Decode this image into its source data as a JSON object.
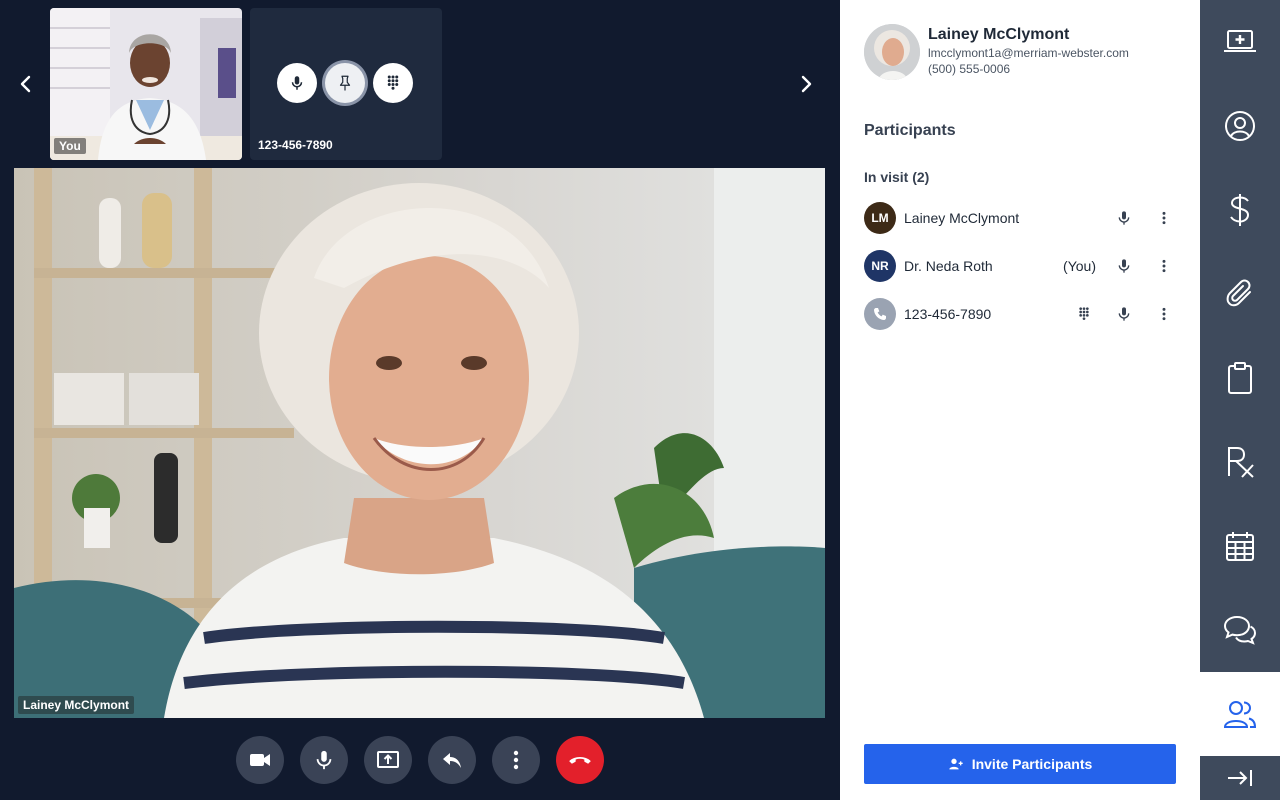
{
  "thumbnails": {
    "self_label": "You",
    "phone_label": "123-456-7890"
  },
  "main_video": {
    "speaker_label": "Lainey McClymont"
  },
  "patient": {
    "name": "Lainey McClymont",
    "email": "lmcclymont1a@merriam-webster.com",
    "phone": "(500) 555-0006"
  },
  "participants_panel": {
    "title": "Participants",
    "section_title": "In visit (2)",
    "items": [
      {
        "initials": "LM",
        "name": "Lainey McClymont",
        "suffix": "",
        "avatar_color": "#3d2a17"
      },
      {
        "initials": "NR",
        "name": "Dr. Neda Roth",
        "suffix": "(You)",
        "avatar_color": "#1f3566"
      },
      {
        "initials": "",
        "name": "123-456-7890",
        "suffix": "",
        "avatar_color": "#9aa3b2"
      }
    ],
    "invite_label": "Invite Participants"
  },
  "nav": {
    "items": [
      "medical-laptop-icon",
      "profile-icon",
      "dollar-icon",
      "paperclip-icon",
      "clipboard-icon",
      "rx-icon",
      "calendar-icon",
      "chat-icon",
      "participants-icon"
    ],
    "active": "participants-icon"
  },
  "colors": {
    "background": "#111a2e",
    "accent": "#2563eb",
    "end_call": "#e3202b",
    "nav": "#3e4a5c"
  }
}
